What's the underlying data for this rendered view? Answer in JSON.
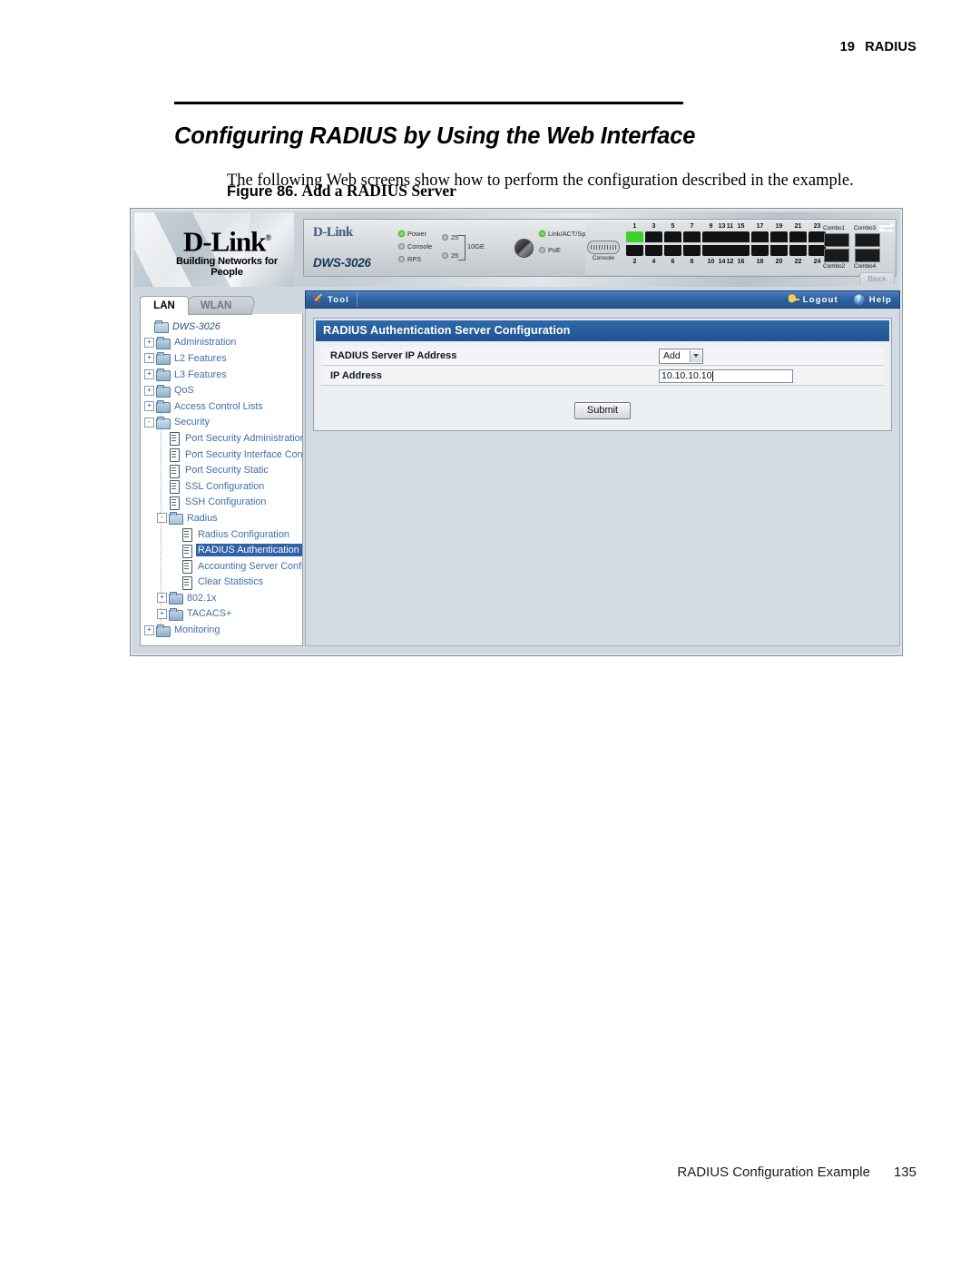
{
  "page": {
    "chapter_number": "19",
    "chapter_title": "RADIUS",
    "section_title": "Configuring RADIUS by Using the Web Interface",
    "body_paragraph": "The following Web screens show how to perform the configuration described in the example.",
    "figure_number": "Figure 86.",
    "figure_title": "Add a RADIUS Server",
    "footer_text": "RADIUS Configuration Example",
    "footer_page_number": "135"
  },
  "figure": {
    "branding": {
      "logo_text": "D-Link",
      "logo_registered": "®",
      "tagline": "Building Networks for People"
    },
    "device": {
      "brand": "D-Link",
      "model": "DWS-3026",
      "leds": [
        {
          "label": "Power",
          "state": "on"
        },
        {
          "label": "Console",
          "state": "off"
        },
        {
          "label": "RPS",
          "state": "off"
        },
        {
          "label": "25",
          "state": "off"
        },
        {
          "label": "25",
          "state": "off"
        },
        {
          "label": "Link/ACT/Spee",
          "state": "on"
        },
        {
          "label": "PoE",
          "state": "off"
        }
      ],
      "ten_ge_label": "10GE",
      "console_label": "Console",
      "ports_top_left": [
        "1",
        "3",
        "5",
        "7",
        "9",
        "11"
      ],
      "ports_bottom_left": [
        "2",
        "4",
        "6",
        "8",
        "10",
        "12"
      ],
      "ports_top_right": [
        "13",
        "15",
        "17",
        "19",
        "21",
        "23"
      ],
      "ports_bottom_right": [
        "14",
        "16",
        "18",
        "20",
        "22",
        "24"
      ],
      "active_port": "1",
      "combo_labels": [
        "Combo1",
        "Combo3",
        "Combo2",
        "Combo4"
      ],
      "block_tab_label": "Block"
    },
    "tabs": [
      {
        "label": "LAN",
        "active": true
      },
      {
        "label": "WLAN",
        "active": false
      }
    ],
    "toolbar": {
      "tool_label": "Tool",
      "logout_label": "Logout",
      "help_label": "Help",
      "help_glyph": "?"
    },
    "nav_tree": [
      {
        "label": "DWS-3026",
        "indent": 1,
        "icon": "folder-open-icon",
        "twisty": "",
        "selected": false,
        "root": true
      },
      {
        "label": "Administration",
        "indent": 1,
        "icon": "folder-icon",
        "twisty": "+",
        "selected": false
      },
      {
        "label": "L2 Features",
        "indent": 1,
        "icon": "folder-icon",
        "twisty": "+",
        "selected": false
      },
      {
        "label": "L3 Features",
        "indent": 1,
        "icon": "folder-icon",
        "twisty": "+",
        "selected": false
      },
      {
        "label": "QoS",
        "indent": 1,
        "icon": "folder-icon",
        "twisty": "+",
        "selected": false
      },
      {
        "label": "Access Control Lists",
        "indent": 1,
        "icon": "folder-icon",
        "twisty": "+",
        "selected": false
      },
      {
        "label": "Security",
        "indent": 1,
        "icon": "folder-open-icon",
        "twisty": "-",
        "selected": false
      },
      {
        "label": "Port Security Administration",
        "indent": 2,
        "icon": "document-icon",
        "twisty": "",
        "selected": false
      },
      {
        "label": "Port Security Interface Configuration",
        "indent": 2,
        "icon": "document-icon",
        "twisty": "",
        "selected": false
      },
      {
        "label": "Port Security Static",
        "indent": 2,
        "icon": "document-icon",
        "twisty": "",
        "selected": false
      },
      {
        "label": "SSL Configuration",
        "indent": 2,
        "icon": "document-icon",
        "twisty": "",
        "selected": false
      },
      {
        "label": "SSH Configuration",
        "indent": 2,
        "icon": "document-icon",
        "twisty": "",
        "selected": false
      },
      {
        "label": "Radius",
        "indent": 2,
        "icon": "folder-open-icon",
        "twisty": "-",
        "selected": false
      },
      {
        "label": "Radius Configuration",
        "indent": 3,
        "icon": "document-icon",
        "twisty": "",
        "selected": false
      },
      {
        "label": "RADIUS Authentication Server Configuration",
        "indent": 3,
        "icon": "document-icon",
        "twisty": "",
        "selected": true
      },
      {
        "label": "Accounting Server Configuration",
        "indent": 3,
        "icon": "document-icon",
        "twisty": "",
        "selected": false
      },
      {
        "label": "Clear Statistics",
        "indent": 3,
        "icon": "document-icon",
        "twisty": "",
        "selected": false
      },
      {
        "label": "802.1x",
        "indent": 2,
        "icon": "folder-icon",
        "twisty": "+",
        "selected": false
      },
      {
        "label": "TACACS+",
        "indent": 2,
        "icon": "folder-icon",
        "twisty": "+",
        "selected": false
      },
      {
        "label": "Monitoring",
        "indent": 1,
        "icon": "folder-icon",
        "twisty": "+",
        "selected": false
      }
    ],
    "panel": {
      "title": "RADIUS Authentication Server Configuration",
      "rows": [
        {
          "label": "RADIUS Server IP Address",
          "control": "select",
          "value": "Add"
        },
        {
          "label": "IP Address",
          "control": "text",
          "value": "10.10.10.10"
        }
      ],
      "submit_label": "Submit"
    }
  },
  "colors": {
    "panel_header_blue": "#1f5290",
    "toolbar_blue": "#2f629f",
    "content_bg": "#d2dbe3",
    "nav_link": "#3f6fa8",
    "selection_blue": "#2d62a8",
    "led_on_green": "#7ae04f",
    "active_port_green": "#3bd22b"
  }
}
